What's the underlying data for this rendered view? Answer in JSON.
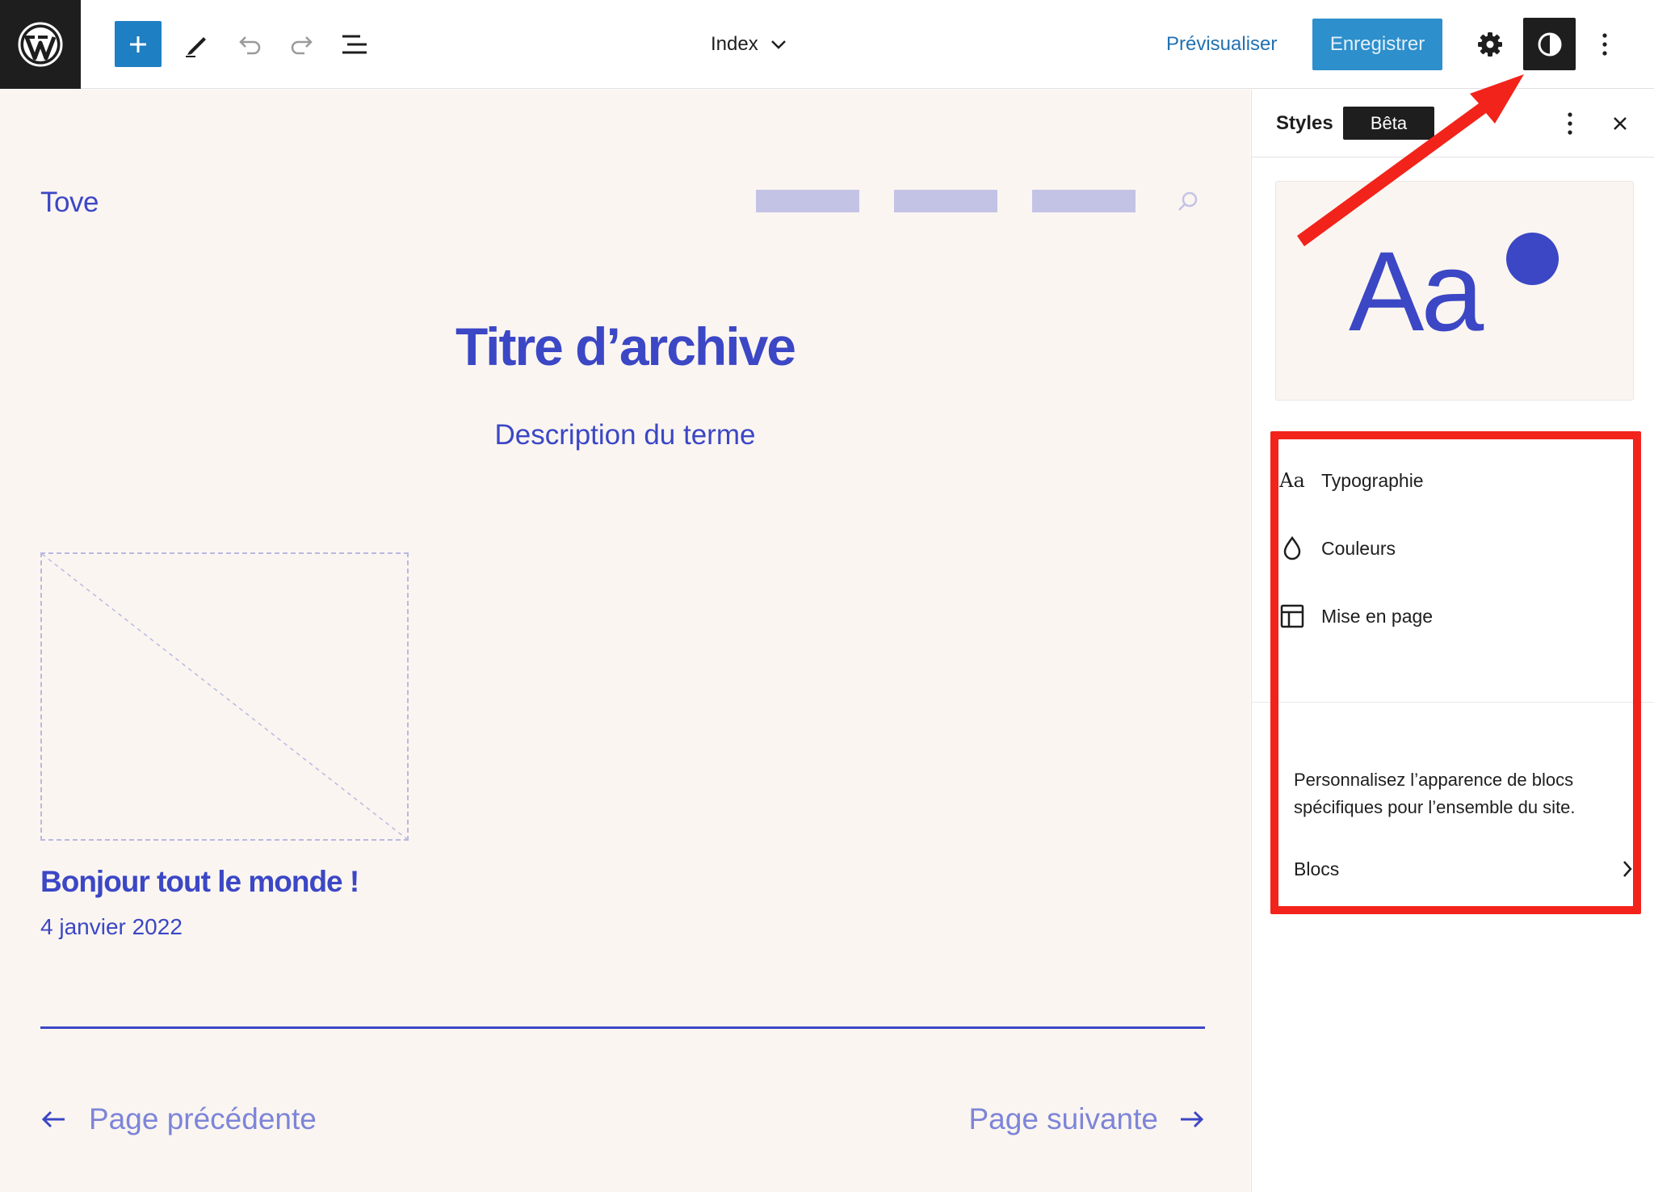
{
  "toolbar": {
    "document_title": "Index",
    "preview_label": "Prévisualiser",
    "save_label": "Enregistrer"
  },
  "canvas": {
    "site_title": "Tove",
    "archive_title": "Titre d’archive",
    "term_description": "Description du terme",
    "post": {
      "title": "Bonjour tout le monde !",
      "date": "4 janvier 2022"
    },
    "pagination": {
      "previous": "Page précédente",
      "next": "Page suivante"
    }
  },
  "sidebar": {
    "title": "Styles",
    "badge": "Bêta",
    "preview_text": "Aa",
    "items": [
      {
        "label": "Typographie",
        "icon": "typography-icon"
      },
      {
        "label": "Couleurs",
        "icon": "color-drop-icon"
      },
      {
        "label": "Mise en page",
        "icon": "layout-icon"
      }
    ],
    "blocks_description": "Personnalisez l’apparence de blocs spécifiques pour l’ensemble du site.",
    "blocks_label": "Blocs"
  },
  "colors": {
    "theme_accent": "#3b47c5",
    "canvas_background": "#fbf5f1",
    "wp_blue": "#2271b1",
    "annotation_red": "#f2231b"
  }
}
